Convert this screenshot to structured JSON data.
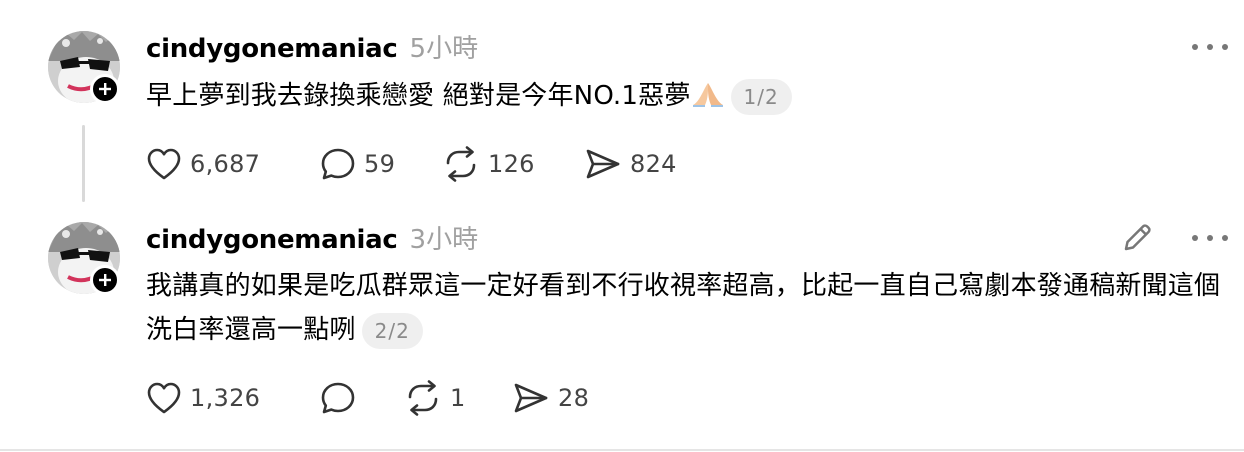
{
  "posts": [
    {
      "username": "cindygonemaniac",
      "time": "5小時",
      "text": "早上夢到我去錄換乘戀愛 絕對是今年NO.1惡夢",
      "emoji": "folded-hands-emoji",
      "page": "1/2",
      "likes": "6,687",
      "replies": "59",
      "reposts": "126",
      "shares": "824"
    },
    {
      "username": "cindygonemaniac",
      "time": "3小時",
      "text": "我講真的如果是吃瓜群眾這一定好看到不行收視率超高，比起一直自己寫劇本發通稿新聞這個洗白率還高一點咧",
      "page": "2/2",
      "likes": "1,326",
      "replies": "",
      "reposts": "1",
      "shares": "28"
    }
  ],
  "icons": {
    "like": "heart-icon",
    "reply": "speech-bubble-icon",
    "repost": "repost-arrows-icon",
    "share": "send-arrow-icon",
    "more": "more-dots-icon",
    "edit": "pencil-icon",
    "follow": "plus-icon"
  },
  "colors": {
    "text": "#000000",
    "muted": "#a0a0a0",
    "count": "#444444",
    "pill_bg": "#efefef",
    "thread_line": "#d9d9d9"
  }
}
